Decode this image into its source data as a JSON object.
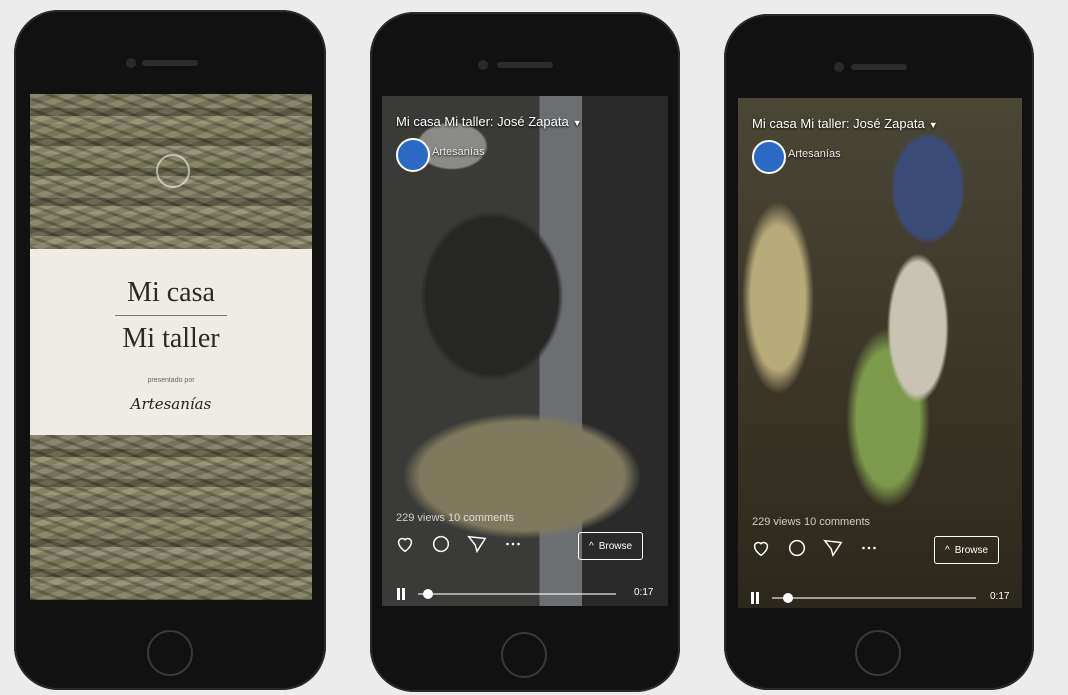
{
  "cover": {
    "title_line1": "Mi casa",
    "title_line2": "Mi taller",
    "presented_by": "presentado por",
    "brand": "Artesanías"
  },
  "videos": [
    {
      "title": "Mi casa Mi taller: José Zapata",
      "channel": "Artesanías",
      "stats": "229 views 10 comments",
      "browse_label": "Browse",
      "time": "0:17",
      "progress": 0.05
    },
    {
      "title": "Mi casa Mi taller: José Zapata",
      "channel": "Artesanías",
      "stats": "229 views 10 comments",
      "browse_label": "Browse",
      "time": "0:17",
      "progress": 0.08
    }
  ],
  "icons": {
    "like": "heart-icon",
    "comment": "comment-icon",
    "share": "send-icon",
    "more": "more-icon",
    "browse": "chevron-up-icon",
    "play": "pause-icon"
  },
  "colors": {
    "phone_body": "#111111",
    "avatar": "#2b6ac4",
    "cover_bg": "#efece6"
  }
}
